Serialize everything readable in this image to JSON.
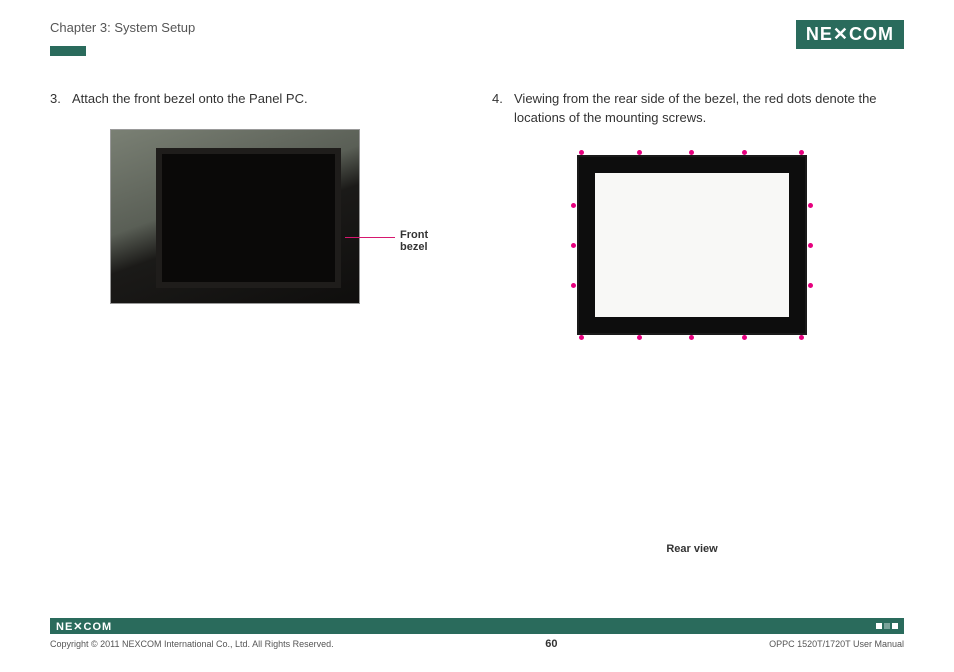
{
  "header": {
    "chapter": "Chapter 3: System Setup",
    "brand": "NE COM",
    "brand_x": "X"
  },
  "left": {
    "step_num": "3.",
    "step_text": "Attach the front bezel onto the Panel PC.",
    "callout": "Front bezel"
  },
  "right": {
    "step_num": "4.",
    "step_text": "Viewing from the rear side of the bezel, the red dots denote the locations of the mounting screws.",
    "rear_label": "Rear view"
  },
  "footer": {
    "brand": "NE COM",
    "copyright": "Copyright © 2011 NEXCOM International Co., Ltd. All Rights Reserved.",
    "page": "60",
    "manual": "OPPC 1520T/1720T User Manual"
  },
  "colors": {
    "accent": "#2a6b5c",
    "dot": "#e6007e"
  }
}
